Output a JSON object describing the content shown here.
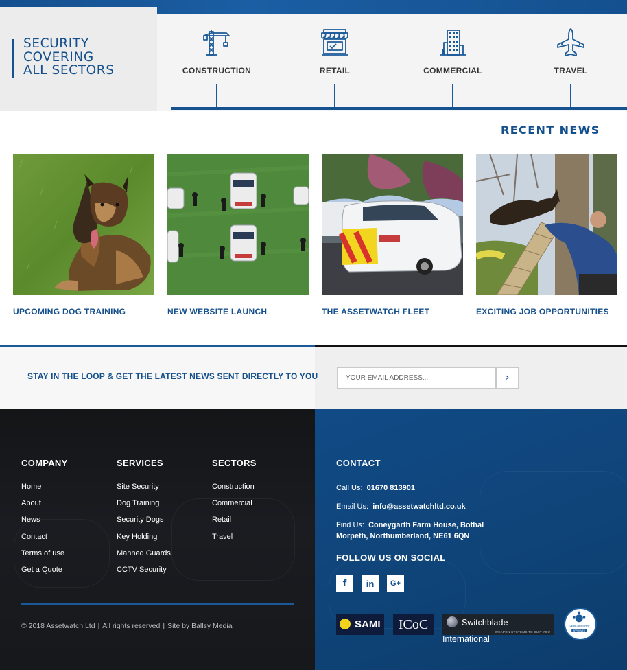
{
  "sectors": {
    "title_lines": [
      "SECURITY",
      "COVERING",
      "ALL SECTORS"
    ],
    "items": [
      {
        "label": "CONSTRUCTION",
        "icon": "crane-icon"
      },
      {
        "label": "RETAIL",
        "icon": "shop-icon"
      },
      {
        "label": "COMMERCIAL",
        "icon": "office-building-icon"
      },
      {
        "label": "TRAVEL",
        "icon": "airplane-icon"
      }
    ]
  },
  "news": {
    "heading": "RECENT NEWS",
    "items": [
      {
        "title": "UPCOMING DOG TRAINING"
      },
      {
        "title": "NEW WEBSITE LAUNCH"
      },
      {
        "title": "THE ASSETWATCH FLEET"
      },
      {
        "title": "EXCITING JOB OPPORTUNITIES"
      }
    ]
  },
  "newsletter": {
    "text": "STAY IN THE LOOP & GET THE LATEST NEWS SENT DIRECTLY TO YOU",
    "placeholder": "YOUR EMAIL ADDRESS...",
    "submit_label": "›"
  },
  "footer": {
    "company": {
      "heading": "COMPANY",
      "links": [
        "Home",
        "About",
        "News",
        "Contact",
        "Terms of use",
        "Get a Quote"
      ]
    },
    "services": {
      "heading": "SERVICES",
      "links": [
        "Site Security",
        "Dog Training",
        "Security Dogs",
        "Key Holding",
        "Manned Guards",
        "CCTV Security"
      ]
    },
    "sectors": {
      "heading": "SECTORS",
      "links": [
        "Construction",
        "Commercial",
        "Retail",
        "Travel"
      ]
    },
    "contact": {
      "heading": "CONTACT",
      "call_label": "Call Us:",
      "phone": "01670 813901",
      "email_label": "Email Us:",
      "email": "info@assetwatchltd.co.uk",
      "find_label": "Find Us:",
      "address_line1": "Coneygarth Farm House, Bothal",
      "address_line2": "Morpeth, Northumberland, NE61 6QN"
    },
    "social": {
      "heading": "FOLLOW US ON SOCIAL",
      "facebook": "f",
      "linkedin": "in",
      "googleplus": "G+"
    },
    "copyright": "© 2018 Assetwatch Ltd",
    "rights": "All rights reserved",
    "credit": "Site by Ballsy Media",
    "separator": "|",
    "badges": {
      "sami": "SAMI",
      "icoc": "ICoC",
      "switchblade": "Switchblade International",
      "switchblade_sub": "WEAPON SYSTEMS TO SUIT YOU",
      "safecontractor": "SafeContractor",
      "safecontractor_sub": "APPROVED"
    }
  },
  "colors": {
    "brand_blue": "#15508c",
    "accent_blue": "#1b5a99",
    "footer_dark": "#16181b",
    "footer_blue": "#0f4478"
  }
}
